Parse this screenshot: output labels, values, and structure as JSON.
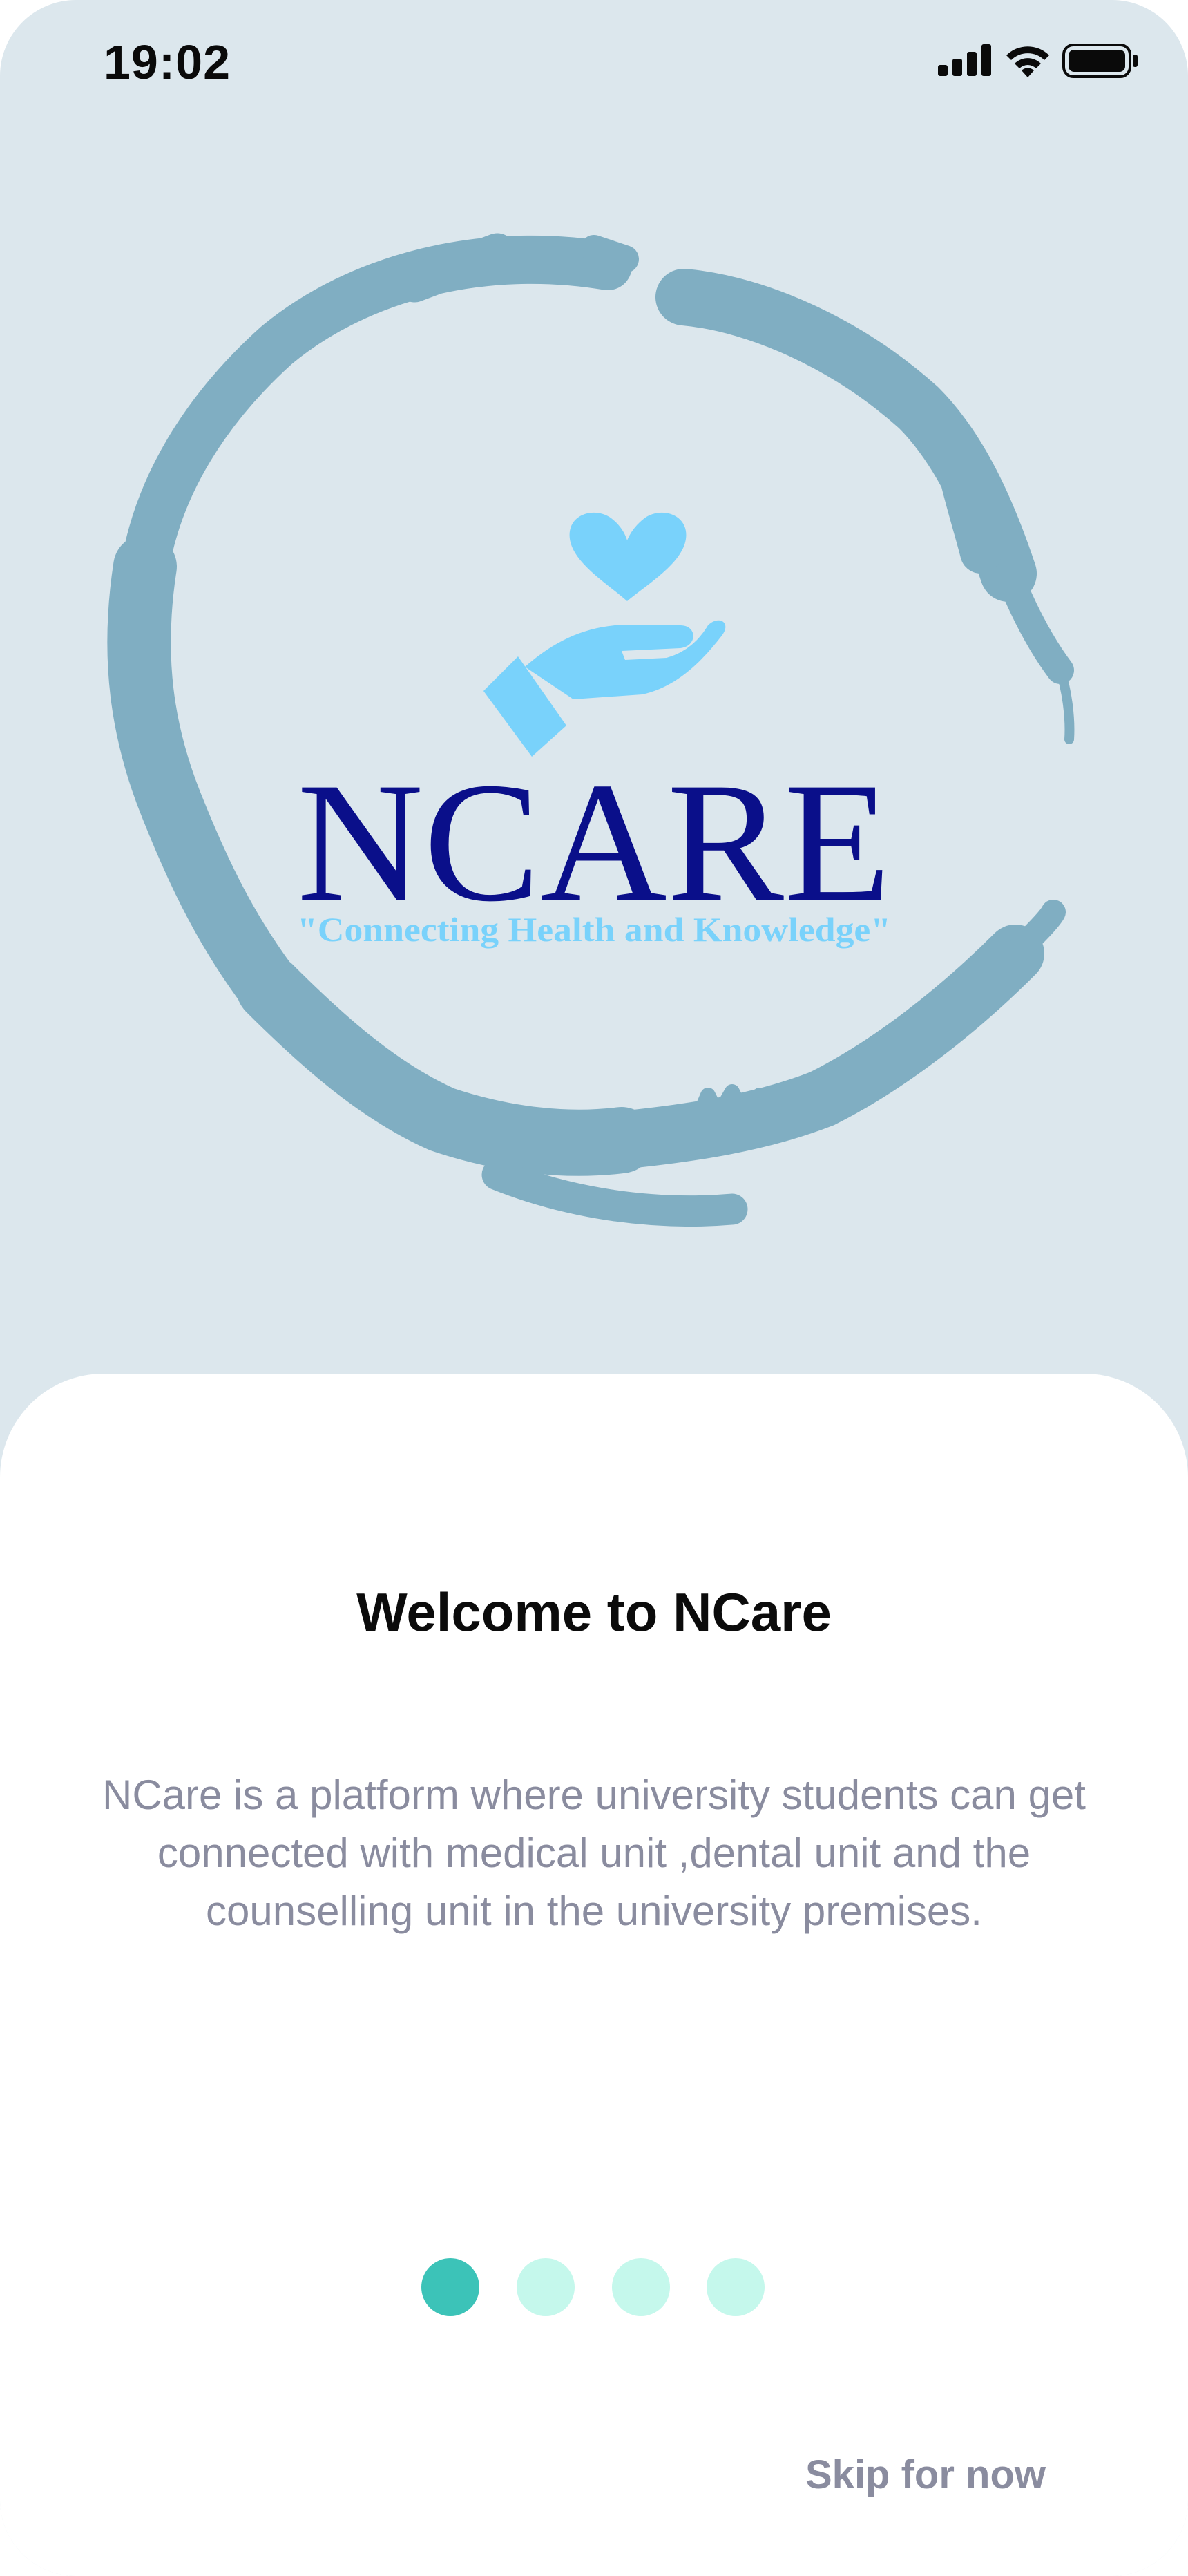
{
  "status_bar": {
    "time": "19:02",
    "icons": [
      "cellular-signal-icon",
      "wifi-icon",
      "battery-icon"
    ]
  },
  "logo": {
    "wordmark": "NCARE",
    "tagline": "\"Connecting Health and Knowledge\"",
    "icons": [
      "heart-icon",
      "hand-icon",
      "brush-ring"
    ]
  },
  "onboarding": {
    "title": "Welcome to NCare",
    "description": "NCare is a platform where university students can get connected with medical unit ,dental unit and the counselling unit in the university premises.",
    "page_indicator": {
      "total": 4,
      "active_index": 0
    },
    "skip_label": "Skip for now"
  },
  "colors": {
    "hero_background": "#dce7ed",
    "ring": "#80aec2",
    "logo_accent": "#79d2fb",
    "wordmark": "#0a0f8a",
    "dot_active": "#3cc3b8",
    "dot_inactive": "#c5f8ec",
    "body_text": "#8a8c9f"
  }
}
